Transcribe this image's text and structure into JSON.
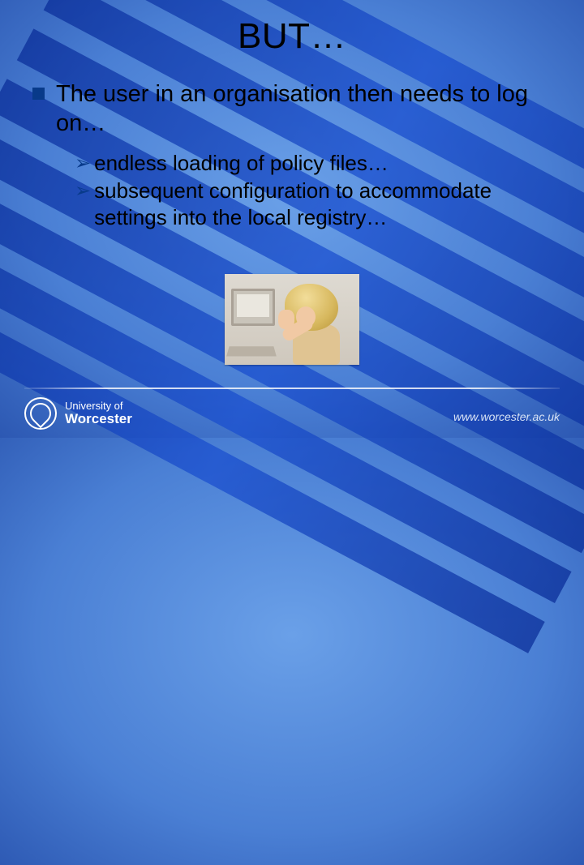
{
  "title": "BUT…",
  "main_bullet": "The user in an organisation then needs to log on…",
  "sub_bullets": [
    "endless loading of policy files…",
    "subsequent configuration to accommodate settings into the local registry…"
  ],
  "image_alt": "Frustrated user at a computer with head in hand",
  "footer": {
    "logo_line1": "University of",
    "logo_line2": "Worcester",
    "url": "www.worcester.ac.uk"
  }
}
